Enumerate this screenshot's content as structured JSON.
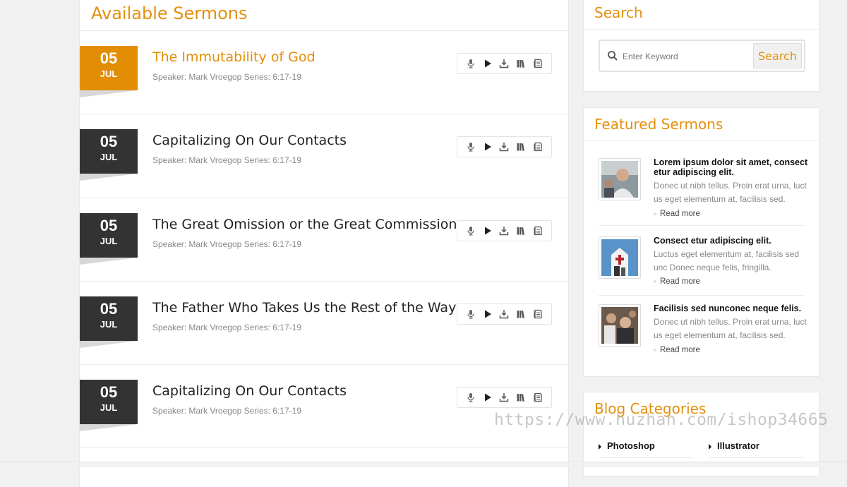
{
  "sermons": {
    "title": "Available Sermons",
    "items": [
      {
        "day": "05",
        "month": "JUL",
        "title": "The Immutability of God",
        "meta": "Speaker: Mark Vroegop Series: 6:17-19",
        "active": true
      },
      {
        "day": "05",
        "month": "JUL",
        "title": "Capitalizing On Our Contacts",
        "meta": "Speaker: Mark Vroegop Series: 6:17-19",
        "active": false
      },
      {
        "day": "05",
        "month": "JUL",
        "title": "The Great Omission or the Great Commission",
        "meta": "Speaker: Mark Vroegop Series: 6:17-19",
        "active": false
      },
      {
        "day": "05",
        "month": "JUL",
        "title": "The Father Who Takes Us the Rest of the Way",
        "meta": "Speaker: Mark Vroegop Series: 6:17-19",
        "active": false
      },
      {
        "day": "05",
        "month": "JUL",
        "title": "Capitalizing On Our Contacts",
        "meta": "Speaker: Mark Vroegop Series: 6:17-19",
        "active": false
      }
    ],
    "tool_icons": [
      "microphone-icon",
      "play-icon",
      "download-icon",
      "book-icon",
      "document-icon"
    ]
  },
  "search": {
    "title": "Search",
    "placeholder": "Enter Keyword",
    "button_label": "Search"
  },
  "featured": {
    "title": "Featured Sermons",
    "items": [
      {
        "title": "Lorem ipsum dolor sit amet, consect etur adipiscing elit.",
        "text": "Donec ut nibh tellus. Proin erat urna, luct us eget elementum at, facilisis sed.",
        "read_more": "Read more"
      },
      {
        "title": "Consect etur adipiscing elit.",
        "text": "Luctus eget elementum at, facilisis sed unc Donec neque felis, fringilla.",
        "read_more": "Read more"
      },
      {
        "title": "Facilisis sed nunconec neque felis.",
        "text": "Donec ut nibh tellus. Proin erat urna, luct us eget elementum at, facilisis sed.",
        "read_more": "Read more"
      }
    ]
  },
  "categories": {
    "title": "Blog Categories",
    "items": [
      "Photoshop",
      "Illustrator"
    ]
  },
  "watermark": "https://www.huzhan.com/ishop34665",
  "colors": {
    "accent": "#e3900e",
    "date_dark": "#333333",
    "date_active": "#e38d05"
  }
}
